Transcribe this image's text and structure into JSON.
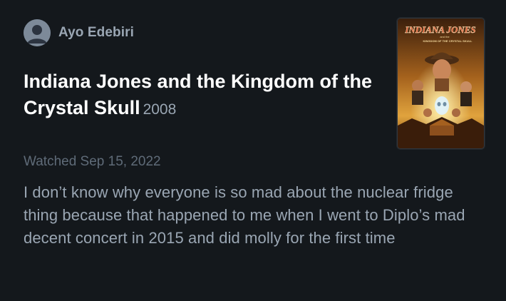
{
  "author": {
    "name": "Ayo Edebiri",
    "avatar_icon": "default-user-avatar"
  },
  "film": {
    "title": "Indiana Jones and the Kingdom of the Crystal Skull",
    "year": "2008",
    "poster": {
      "logo_text": "INDIANA JONES",
      "subtitle_small": "and the",
      "subtitle": "KINGDOM OF THE CRYSTAL SKULL"
    }
  },
  "entry": {
    "watched_label": "Watched Sep 15, 2022"
  },
  "review": {
    "text": "I don’t know why everyone is so mad about the nuclear fridge thing because that happened to me when I went to Diplo’s mad decent concert in 2015 and did molly for the first time"
  },
  "colors": {
    "background": "#14181c",
    "text_primary": "#ffffff",
    "text_secondary": "#9aa6b3",
    "text_muted": "#5f6b78"
  }
}
